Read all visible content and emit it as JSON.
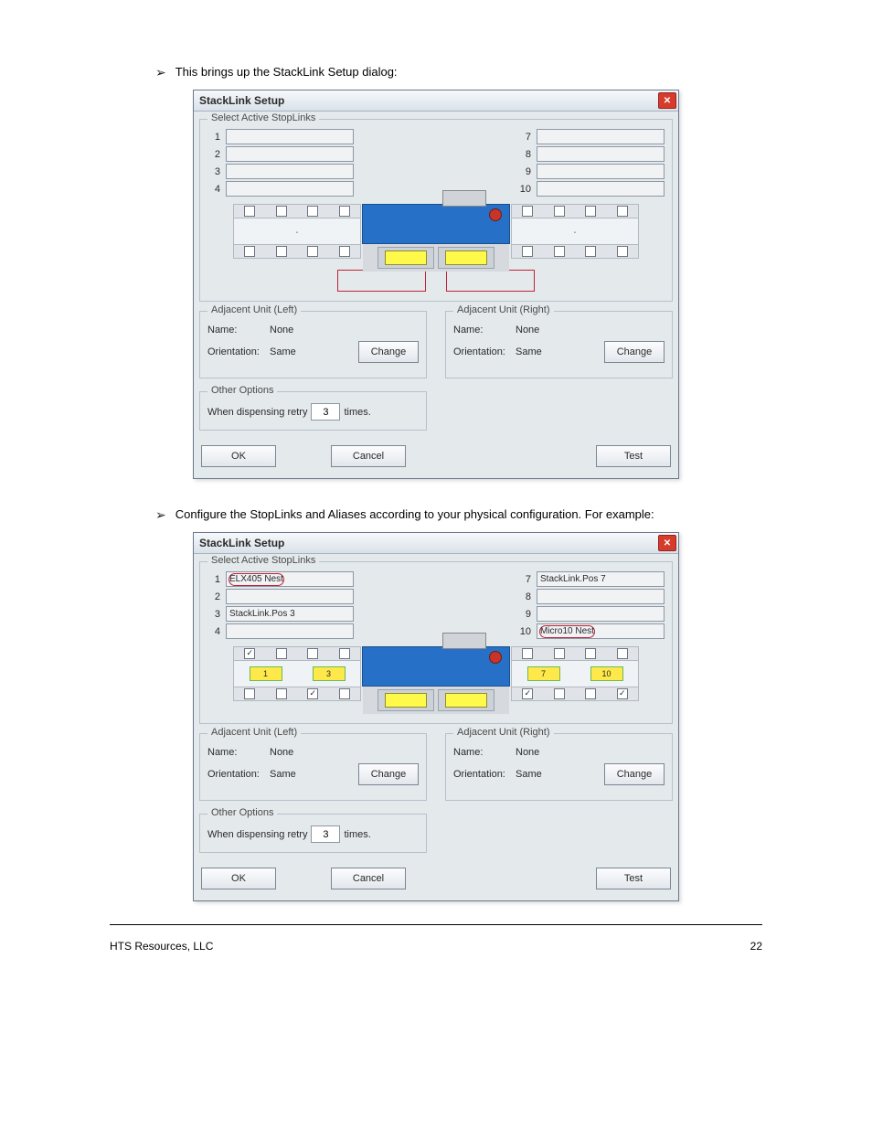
{
  "instruction1": "This brings up the StackLink Setup dialog:",
  "instruction2": "Configure the StopLinks and Aliases according to your physical configuration. For example:",
  "dialog": {
    "title": "StackLink Setup",
    "group_select": "Select Active StopLinks",
    "numbers_left": [
      "1",
      "2",
      "3",
      "4"
    ],
    "numbers_right": [
      "7",
      "8",
      "9",
      "10"
    ],
    "adj_left_legend": "Adjacent Unit (Left)",
    "adj_right_legend": "Adjacent Unit (Right)",
    "name_label": "Name:",
    "name_value": "None",
    "orient_label": "Orientation:",
    "orient_value": "Same",
    "change_btn": "Change",
    "other_legend": "Other Options",
    "retry_prefix": "When dispensing retry",
    "retry_value": "3",
    "retry_suffix": "times.",
    "ok": "OK",
    "cancel": "Cancel",
    "test": "Test"
  },
  "dialog2_fields": {
    "slot1": "ELX405 Nest",
    "slot3": "StackLink.Pos 3",
    "slot7": "StackLink.Pos 7",
    "slot10": "Micro10 Nest",
    "pos_left_a": "1",
    "pos_left_b": "3",
    "pos_right_a": "7",
    "pos_right_b": "10"
  },
  "footer_left": "HTS Resources, LLC",
  "footer_right": "22"
}
